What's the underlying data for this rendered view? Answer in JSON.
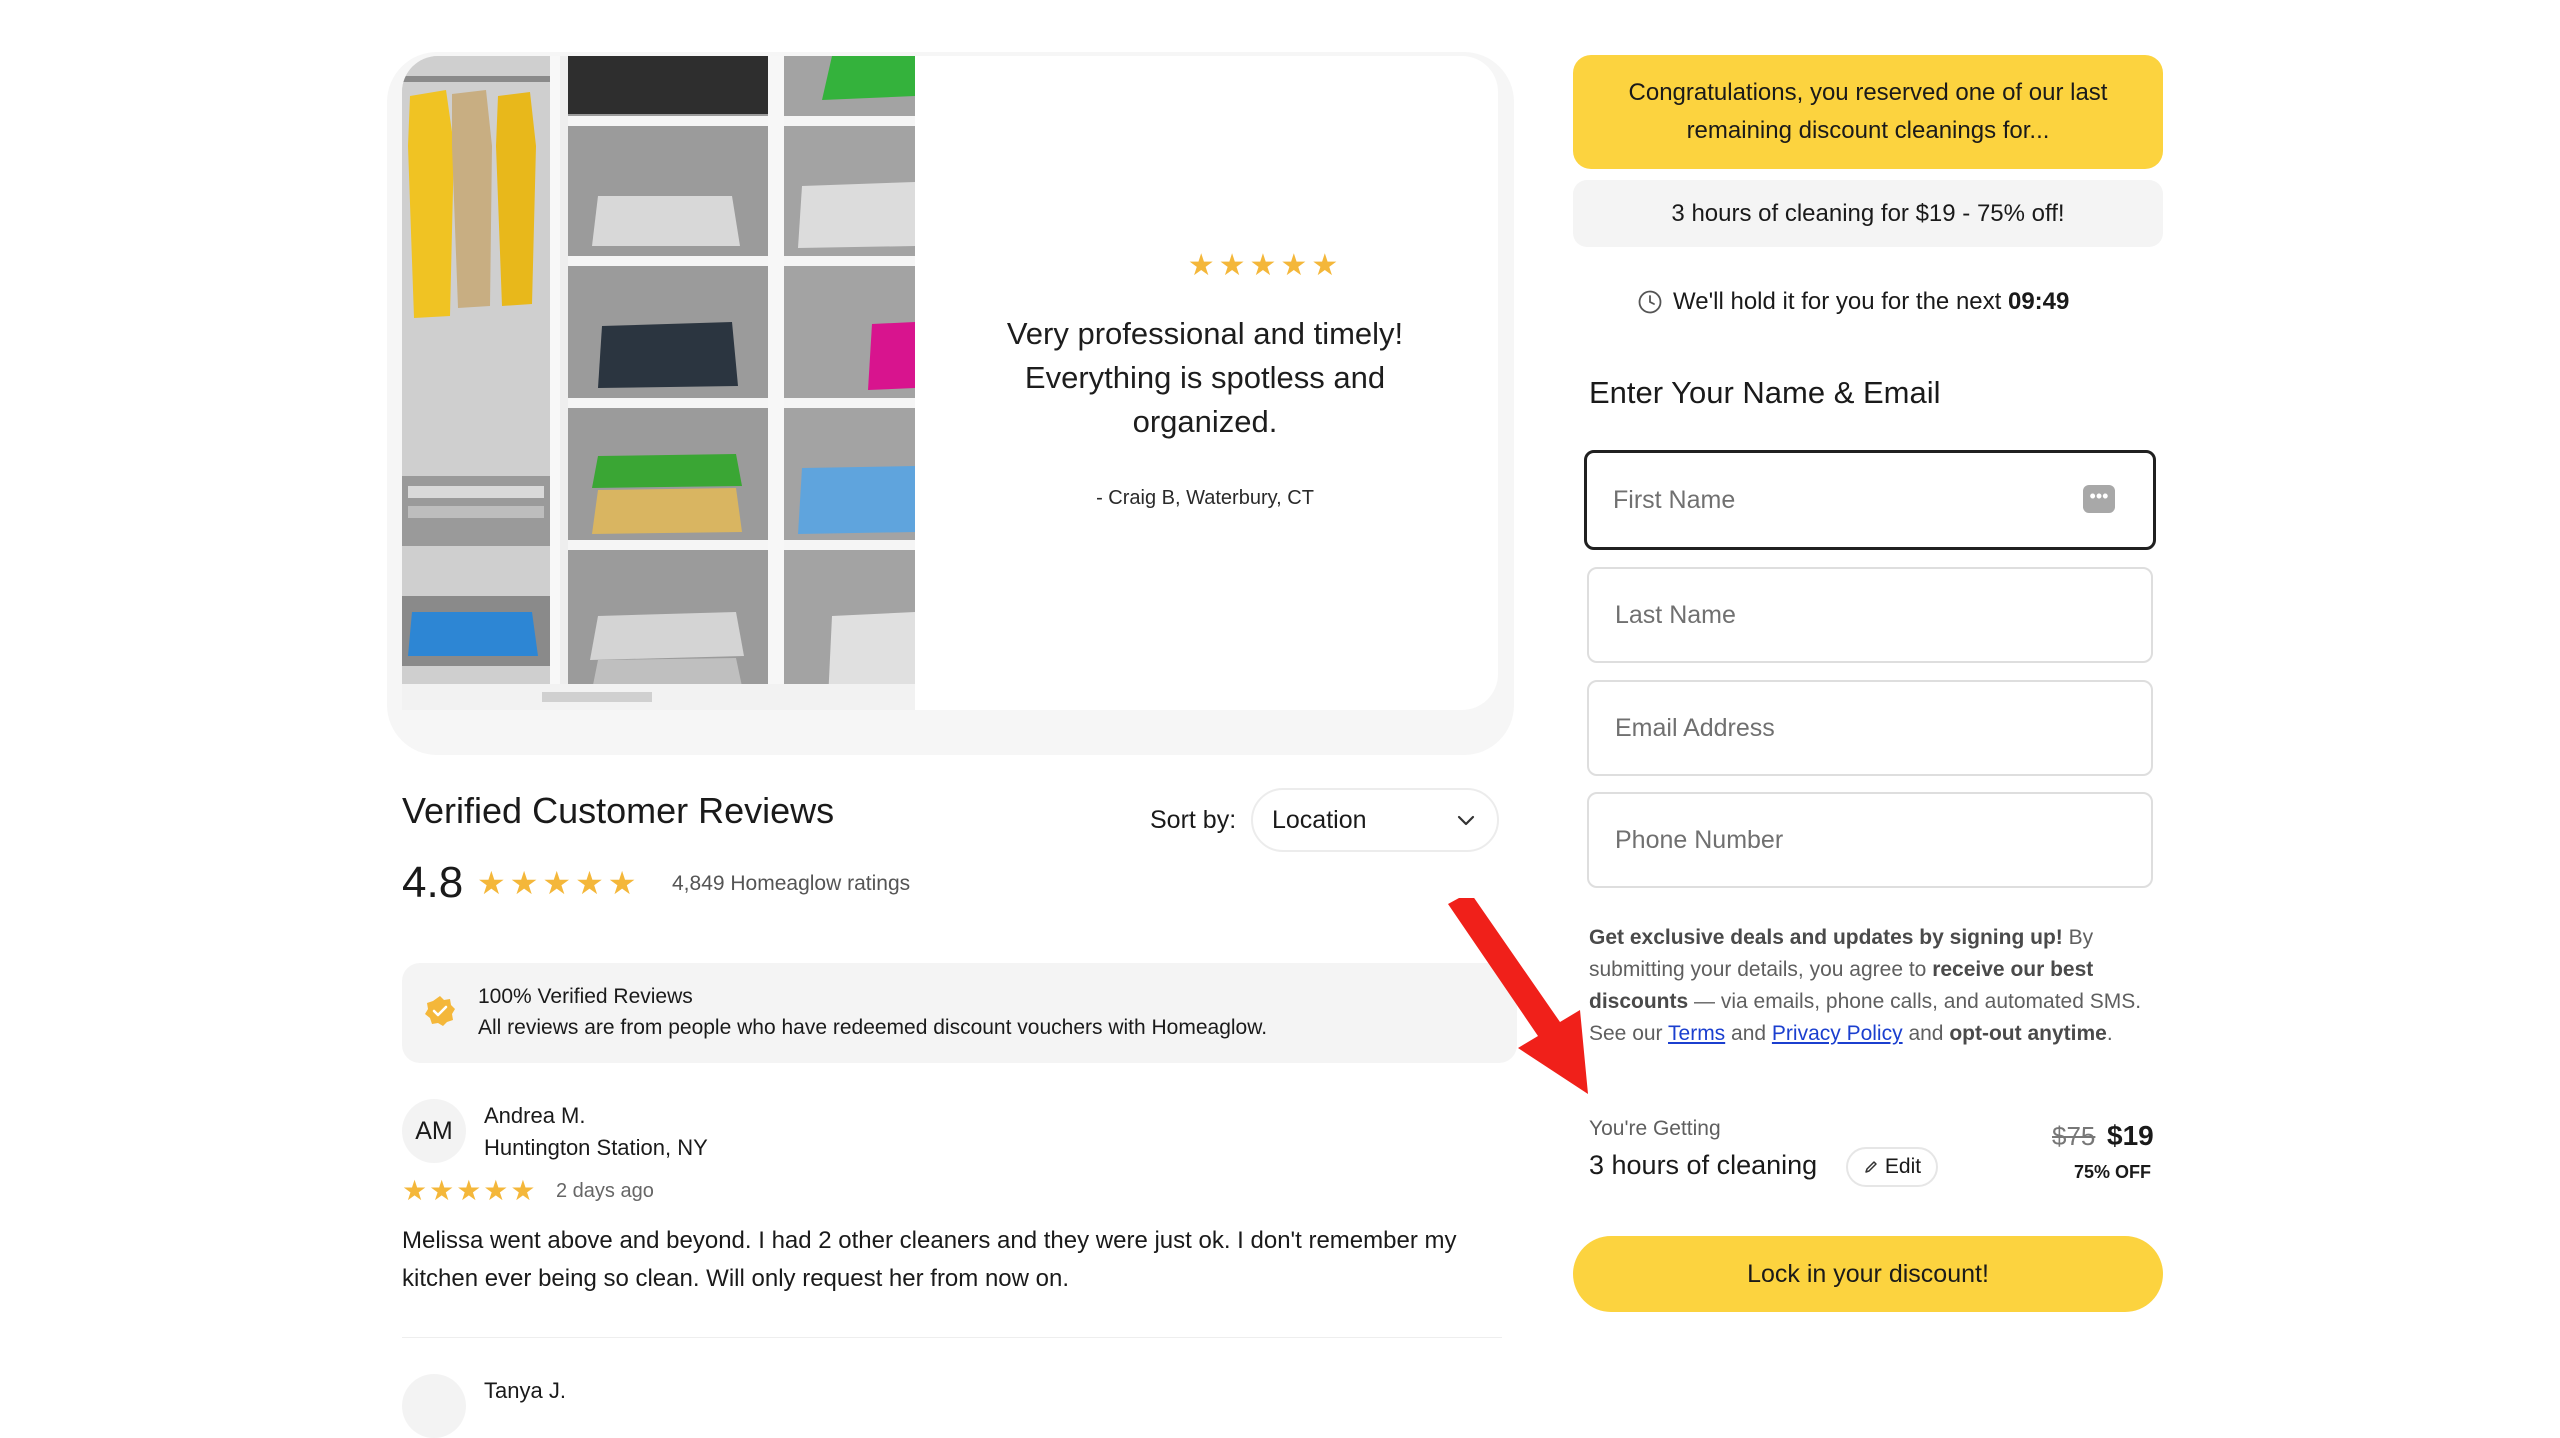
{
  "testimonial": {
    "stars": "★★★★★",
    "quote": "Very professional and timely! Everything is spotless and organized.",
    "author": "- Craig B, Waterbury, CT"
  },
  "reviews": {
    "title": "Verified Customer Reviews",
    "sort_label": "Sort by:",
    "sort_value": "Location",
    "rating": "4.8",
    "rating_stars": "★★★★★",
    "rating_count": "4,849 Homeaglow ratings",
    "verified_title": "100% Verified Reviews",
    "verified_text": "All reviews are from people who have redeemed discount vouchers with Homeaglow.",
    "items": [
      {
        "initials": "AM",
        "name": "Andrea M.",
        "location": "Huntington Station, NY",
        "stars": "★★★★★",
        "date": "2 days ago",
        "text": "Melissa went above and beyond. I had 2 other cleaners and they were just ok. I don't remember my kitchen ever being so clean. Will only request her from now on."
      },
      {
        "name": "Tanya J."
      }
    ]
  },
  "offer_panel": {
    "congrats": "Congratulations, you reserved one of our last remaining discount cleanings for...",
    "offer": "3 hours of cleaning for $19 - 75% off!",
    "timer_text": "We'll hold it for you for the next",
    "timer_value": "09:49",
    "form_title": "Enter Your Name & Email",
    "fields": {
      "first_name": "First Name",
      "last_name": "Last Name",
      "email": "Email Address",
      "phone": "Phone Number"
    },
    "consent": {
      "lead_bold": "Get exclusive deals and updates by signing up!",
      "part1": " By submitting your details, you agree to ",
      "bold2": "receive our best discounts",
      "part2": " — via emails, phone calls, and automated SMS. See our ",
      "terms": "Terms",
      "and": " and ",
      "privacy": "Privacy Policy",
      "part3": " and ",
      "bold3": "opt-out anytime",
      "end": "."
    },
    "getting_label": "You're Getting",
    "getting_value": "3 hours of cleaning",
    "edit_label": "Edit",
    "old_price": "$75",
    "new_price": "$19",
    "off_label": "75% OFF",
    "cta": "Lock in your discount!"
  },
  "colors": {
    "accent_yellow": "#fcd33f",
    "star": "#f4b73a",
    "link": "#1b3fcf",
    "annotation_arrow": "#f0201a"
  }
}
